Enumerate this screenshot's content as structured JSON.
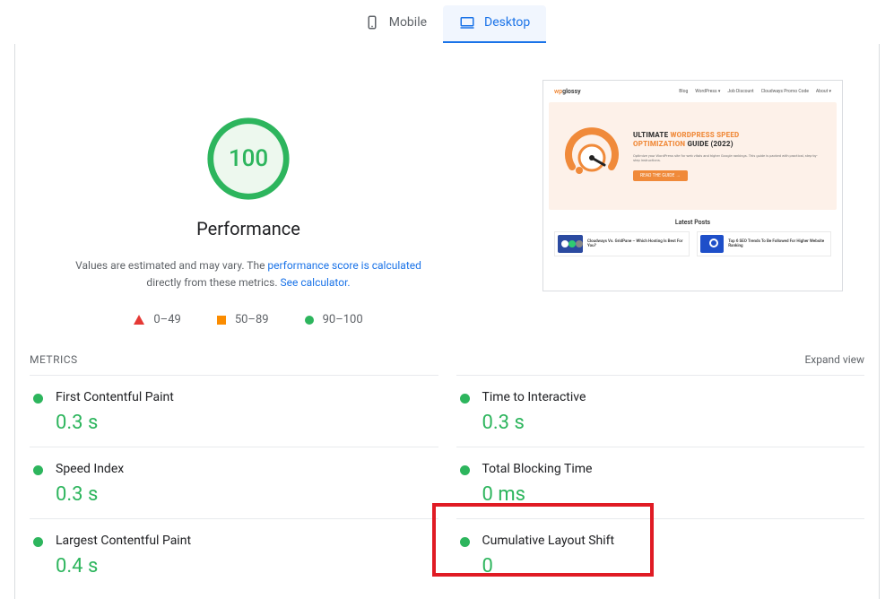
{
  "tabs": {
    "mobile": "Mobile",
    "desktop": "Desktop"
  },
  "score": {
    "value": "100",
    "label": "Performance"
  },
  "estimate": {
    "prefix": "Values are estimated and may vary. The ",
    "link1": "performance score is calculated",
    "middle": " directly from these metrics. ",
    "link2": "See calculator."
  },
  "legend": {
    "r0_49": "0–49",
    "r50_89": "50–89",
    "r90_100": "90–100"
  },
  "preview": {
    "logo_w": "wp",
    "logo_g": "glossy",
    "nav": [
      "Blog",
      "WordPress ▾",
      "Job Discount",
      "Cloudways Promo Code",
      "About ▾"
    ],
    "hero_line1_a": "ULTIMATE ",
    "hero_line1_b": "WORDPRESS SPEED",
    "hero_line2_a": "OPTIMIZATION ",
    "hero_line2_b": "GUIDE (2022)",
    "hero_p": "Optimize your WordPress site for web vitals and higher Google rankings. This guide is packed with practical, step-by-step instructions.",
    "hero_btn": "READ THE GUIDE →",
    "latest": "Latest Posts",
    "post1": "Cloudways Vs. GridPane – Which Hosting Is Best For You?",
    "post2": "Top 6 SEO Trends To Be Followed For Higher Website Ranking"
  },
  "metrics_header": {
    "label": "METRICS",
    "expand": "Expand view"
  },
  "metrics": {
    "fcp": {
      "name": "First Contentful Paint",
      "value": "0.3 s"
    },
    "tti": {
      "name": "Time to Interactive",
      "value": "0.3 s"
    },
    "si": {
      "name": "Speed Index",
      "value": "0.3 s"
    },
    "tbt": {
      "name": "Total Blocking Time",
      "value": "0 ms"
    },
    "lcp": {
      "name": "Largest Contentful Paint",
      "value": "0.4 s"
    },
    "cls": {
      "name": "Cumulative Layout Shift",
      "value": "0"
    }
  }
}
